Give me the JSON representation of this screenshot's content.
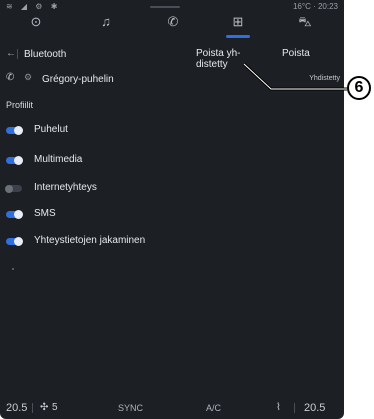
{
  "status_bar": {
    "left_icons": "≋ ◢ ⚙ ✱",
    "right_text": "16°C · 20:23"
  },
  "tabs": [
    {
      "icon": "navigation-icon",
      "glyph": "⊙"
    },
    {
      "icon": "music-icon",
      "glyph": "♫"
    },
    {
      "icon": "phone-icon",
      "glyph": "✆"
    },
    {
      "icon": "apps-icon",
      "glyph": "⊞"
    },
    {
      "icon": "car-icon",
      "glyph": "⛍"
    }
  ],
  "header": {
    "back_glyph": "←",
    "title": "Bluetooth",
    "disconnect_label": "Poista yh-distetty",
    "remove_label": "Poista"
  },
  "device": {
    "phone_glyph": "✆",
    "gear_glyph": "⚙",
    "name": "Grégory-puhelin",
    "status": "Yhdistetty"
  },
  "profiles": {
    "title": "Profiilit",
    "items": [
      {
        "label": "Puhelut",
        "on": true
      },
      {
        "label": "Multimedia",
        "on": true
      },
      {
        "label": "Internetyhteys",
        "on": false
      },
      {
        "label": "SMS",
        "on": true
      },
      {
        "label": "Yhteystietojen jakaminen",
        "on": true
      }
    ]
  },
  "bottom_bar": {
    "left_temp": "20.5",
    "fan_level": "5",
    "sync": "SYNC",
    "ac": "A/C",
    "right_temp": "20.5"
  },
  "callout": {
    "number": "6"
  },
  "colors": {
    "accent": "#2f6fe0",
    "background": "#1c1f24",
    "text": "#e6e9ee"
  }
}
